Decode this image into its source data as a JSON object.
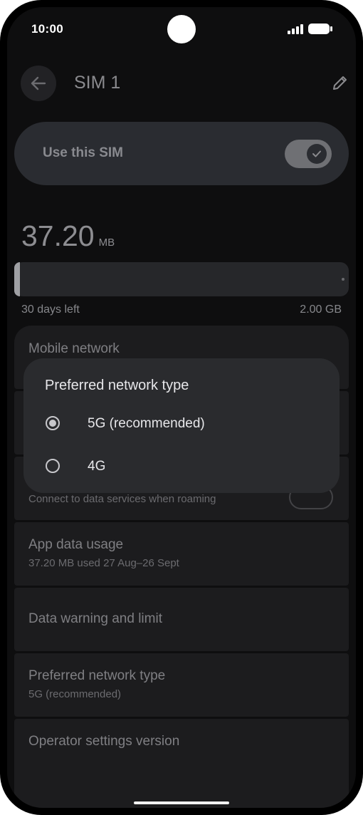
{
  "status_bar": {
    "time": "10:00"
  },
  "app_bar": {
    "title": "SIM 1"
  },
  "use_sim": {
    "label": "Use this SIM",
    "enabled": true
  },
  "usage": {
    "amount": "37.20",
    "unit": "MB",
    "days_left": "30 days left",
    "limit": "2.00 GB",
    "fraction": 0.018
  },
  "settings": {
    "mobile_network": {
      "title": "Mobile network"
    },
    "roaming": {
      "subtitle": "Connect to data services when roaming"
    },
    "app_data_usage": {
      "title": "App data usage",
      "subtitle": "37.20 MB used 27 Aug–26 Sept"
    },
    "data_warning": {
      "title": "Data warning and limit"
    },
    "preferred_network": {
      "title": "Preferred network type",
      "subtitle": "5G (recommended)"
    },
    "operator_settings": {
      "title": "Operator settings version"
    }
  },
  "dialog": {
    "title": "Preferred network type",
    "options": [
      {
        "label": "5G (recommended)",
        "selected": true
      },
      {
        "label": "4G",
        "selected": false
      }
    ]
  },
  "colors": {
    "background": "#0e0e0f",
    "card": "#1c1c1e",
    "dialog": "#2a2b2e",
    "accent": "#c7c7cb"
  },
  "icons": {
    "back": "arrow-left-icon",
    "edit": "pencil-icon",
    "check": "check-icon"
  }
}
